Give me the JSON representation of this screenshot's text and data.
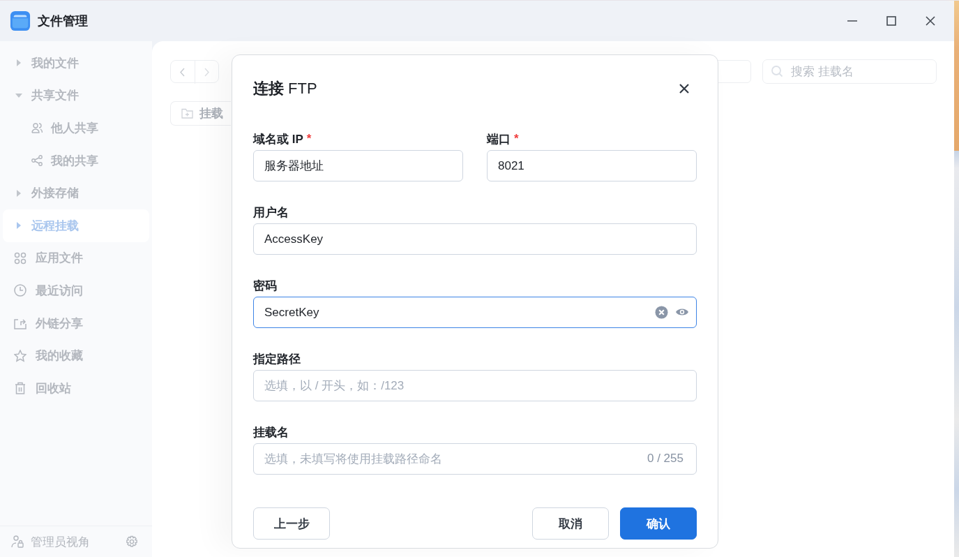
{
  "window": {
    "title": "文件管理"
  },
  "sidebar": {
    "items": [
      {
        "kind": "group",
        "label": "我的文件",
        "expanded": false,
        "selected": false
      },
      {
        "kind": "group",
        "label": "共享文件",
        "expanded": true,
        "selected": false,
        "children": [
          {
            "label": "他人共享"
          },
          {
            "label": "我的共享"
          }
        ]
      },
      {
        "kind": "group",
        "label": "外接存储",
        "expanded": false,
        "selected": false
      },
      {
        "kind": "group",
        "label": "远程挂载",
        "expanded": false,
        "selected": true
      },
      {
        "kind": "link",
        "label": "应用文件",
        "selected": false
      },
      {
        "kind": "link",
        "label": "最近访问",
        "selected": false
      },
      {
        "kind": "link",
        "label": "外链分享",
        "selected": false
      },
      {
        "kind": "link",
        "label": "我的收藏",
        "selected": false
      },
      {
        "kind": "link",
        "label": "回收站",
        "selected": false
      }
    ],
    "footer": {
      "label": "管理员视角"
    }
  },
  "toolbar": {
    "mount_button": "挂载",
    "search": {
      "placeholder": "搜索 挂载名"
    }
  },
  "dialog": {
    "title": "**连接** FTP",
    "fields": [
      {
        "label": "域名或 IP",
        "required_mark": "*",
        "value": "服务器地址",
        "focused": false
      },
      {
        "label": "端口",
        "required_mark": "*",
        "value": "8021",
        "focused": false
      },
      {
        "label": "用户名",
        "value": "AccessKey",
        "focused": false
      },
      {
        "label": "密码",
        "value": "SecretKey",
        "focused": true,
        "kind": "password"
      },
      {
        "label": "指定路径",
        "placeholder": "选填，以 / 开头，如：/123",
        "focused": false
      },
      {
        "label": "挂载名",
        "placeholder": "选填，未填写将使用挂载路径命名",
        "counter": "0 / 255",
        "focused": false
      }
    ],
    "buttons": [
      {
        "label": "上一步",
        "kind": "secondary"
      },
      {
        "label": "取消",
        "kind": "secondary"
      },
      {
        "label": "确认",
        "kind": "primary"
      }
    ]
  }
}
